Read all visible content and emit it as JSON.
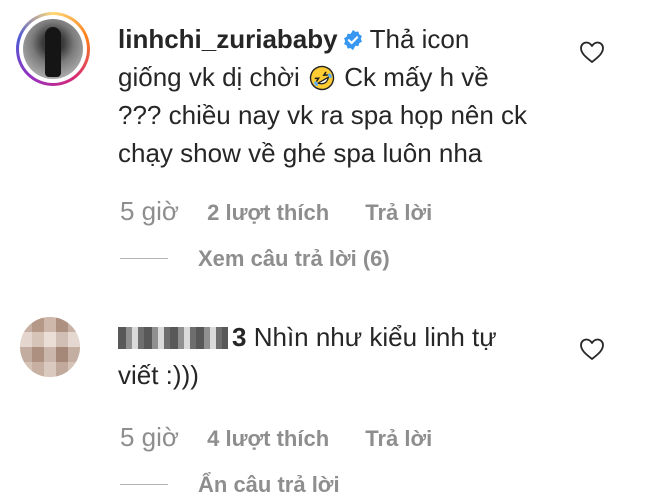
{
  "comments": [
    {
      "username": "linhchi_zuriababy",
      "text_line1_after_name": "Thả icon",
      "text_line2_pre_emoji": "giống vk dị chời",
      "text_line2_post_emoji": "Ck mấy h về",
      "text_line3": "??? chiều nay vk ra spa họp nên ck",
      "text_line4": "chạy show về ghé spa luôn nha",
      "emoji_name": "rolling-on-floor-laughing-emoji",
      "time": "5 giờ",
      "likes": "2 lượt thích",
      "reply": "Trả lời",
      "view_replies": "Xem câu trả lời (6)"
    },
    {
      "username_visible_suffix": "3",
      "text_line1": "Nhìn như kiểu linh tự",
      "text_line2": "viết :)))",
      "time": "5 giờ",
      "likes": "4 lượt thích",
      "reply": "Trả lời",
      "hide_replies": "Ẩn câu trả lời"
    }
  ],
  "colors": {
    "text": "#262626",
    "secondary": "#8e8e8e",
    "verified_blue": "#3897f0"
  }
}
